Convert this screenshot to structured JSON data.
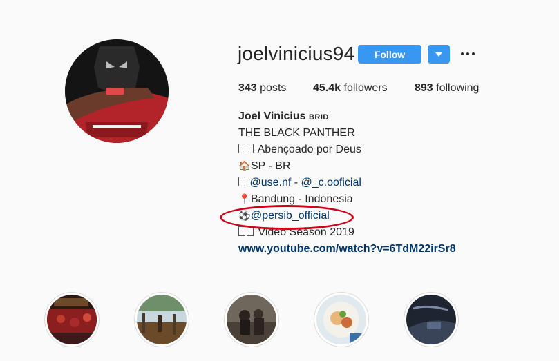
{
  "profile": {
    "username": "joelvinicius94",
    "follow_label": "Follow",
    "posts_count": "343",
    "posts_label": "posts",
    "followers_count": "45.4k",
    "followers_label": "followers",
    "following_count": "893",
    "following_label": "following"
  },
  "bio": {
    "name": "Joel Vinicius",
    "name_tag": "BRID",
    "line1": "THE BLACK PANTHER",
    "line2": "Abençoado por Deus",
    "line3": "SP - BR",
    "line4_mention1": "@use.nf",
    "line4_sep": " - ",
    "line4_mention2": "@_c.ooficial",
    "line5": "Bandung - Indonesia",
    "line6_mention": "@persib_official",
    "line7": "Video Season 2019",
    "link": "www.youtube.com/watch?v=6TdM22irSr8"
  },
  "icons": {
    "house": "🏠",
    "pin": "📍",
    "ball": "⚽"
  },
  "colors": {
    "follow_button": "#3897f0",
    "mention": "#003569",
    "highlight_ellipse": "#d0021b"
  }
}
